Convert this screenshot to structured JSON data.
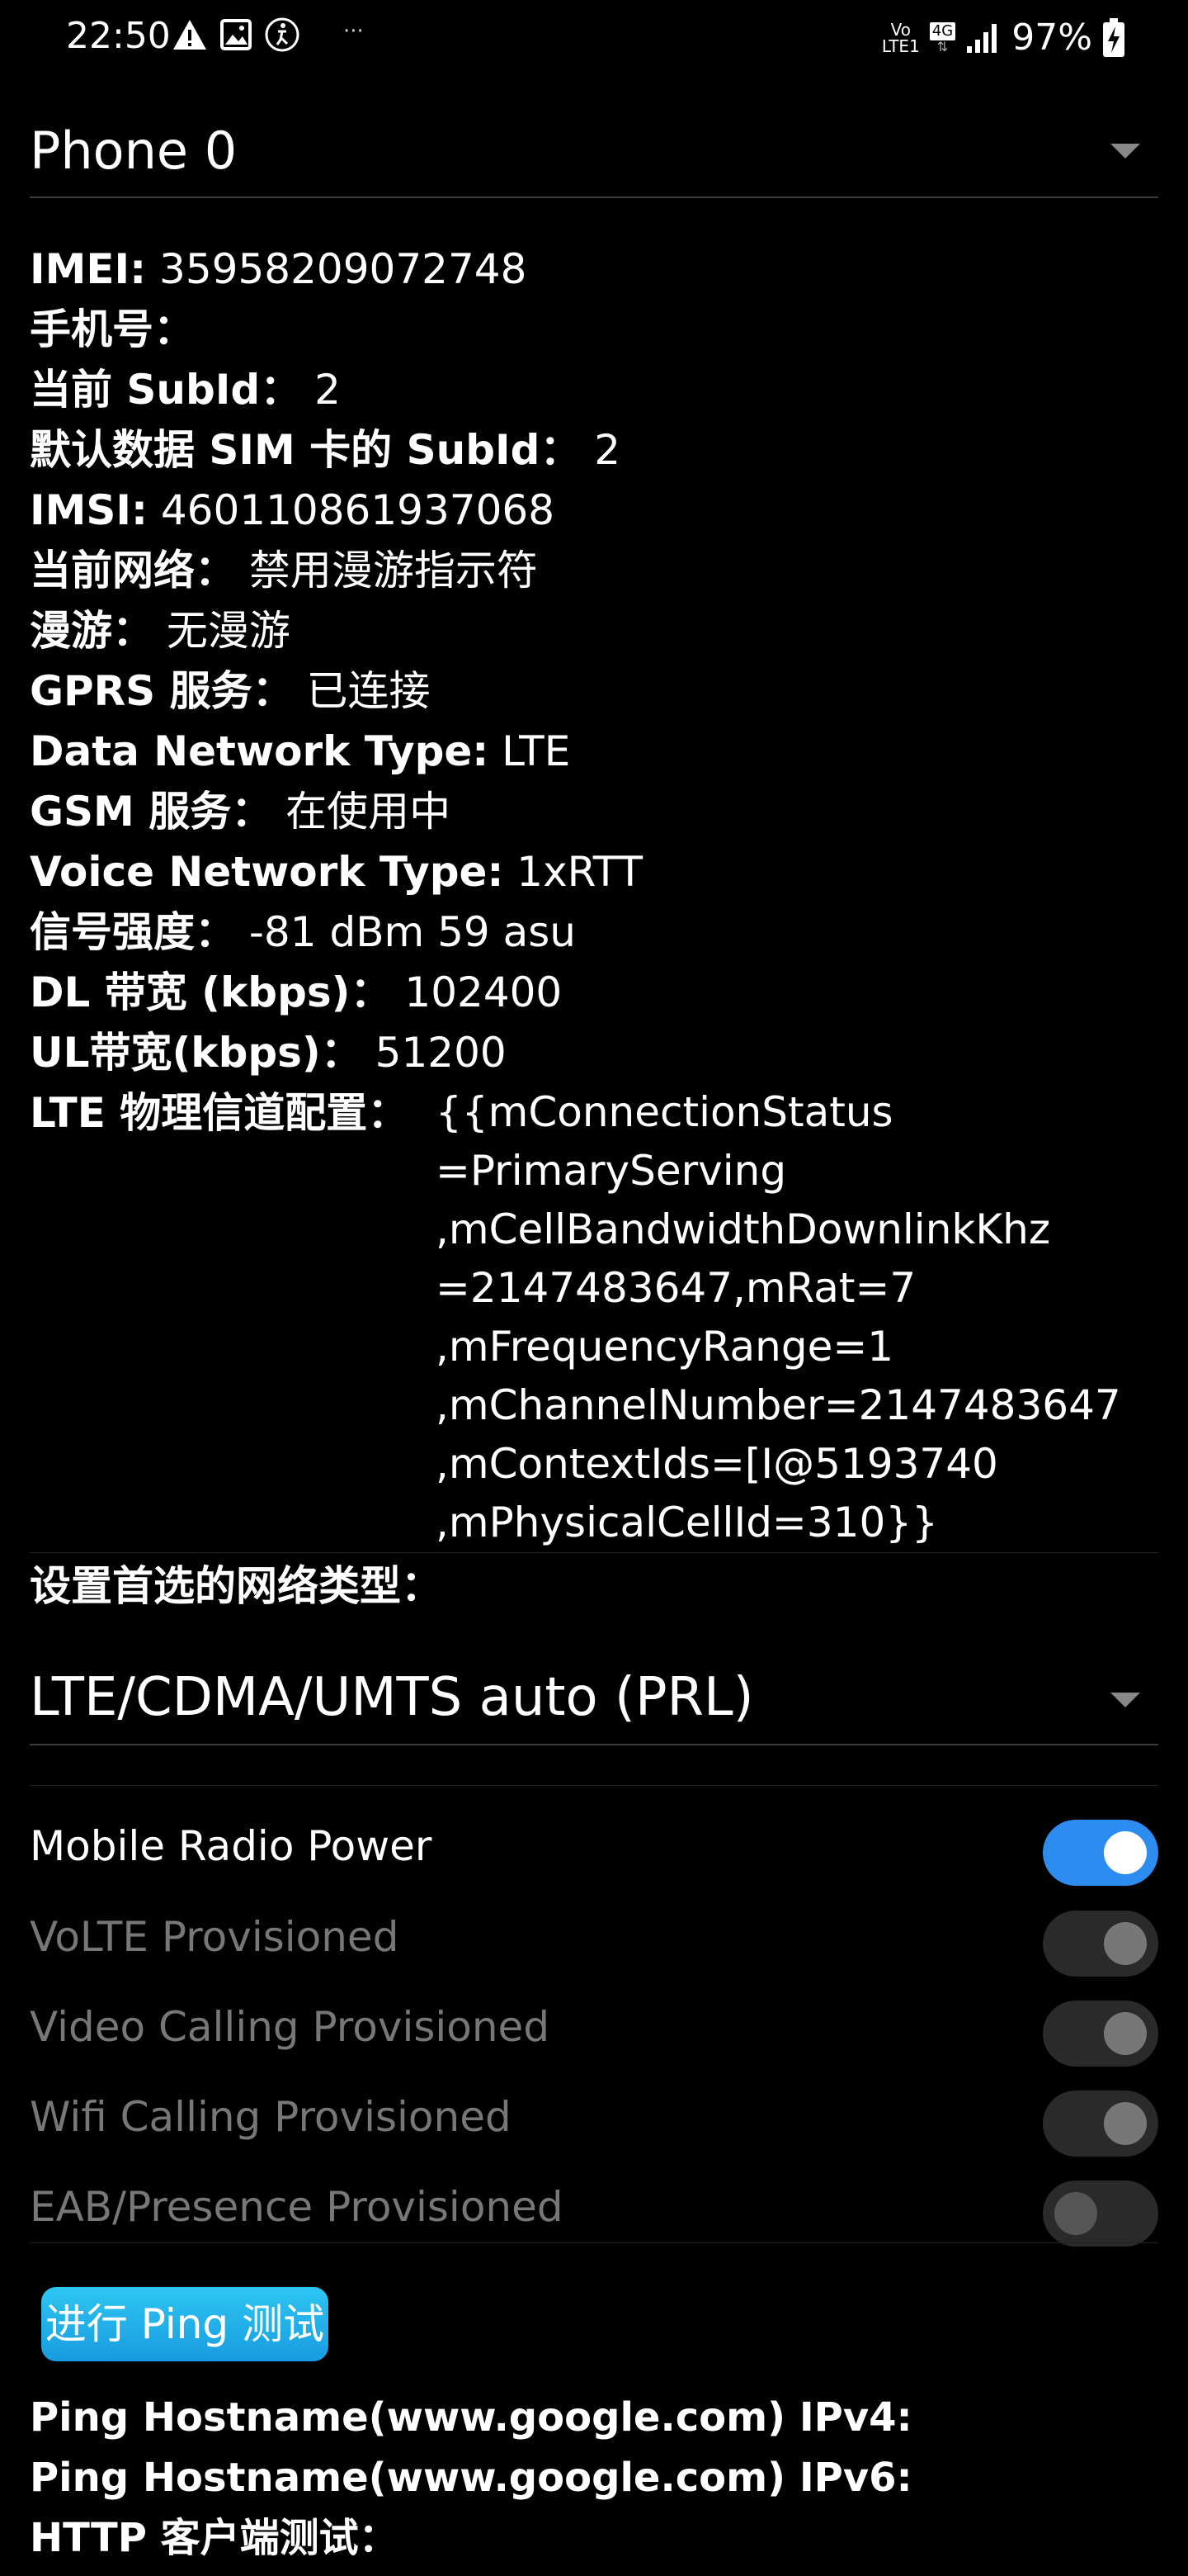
{
  "status_bar": {
    "time": "22:50",
    "left_icons": [
      "warning-icon",
      "image-icon",
      "accessibility-icon"
    ],
    "more": "···",
    "volte": "Vo\nLTE1",
    "network": "4G",
    "battery": "97%"
  },
  "phone_select": {
    "selected": "Phone 0"
  },
  "info_rows": [
    {
      "label": "IMEI:",
      "value": " 35958209072748"
    },
    {
      "label": "手机号：",
      "value": ""
    },
    {
      "label": "当前 SubId：",
      "value": " 2"
    },
    {
      "label": "默认数据 SIM 卡的 SubId：",
      "value": " 2"
    },
    {
      "label": "IMSI:",
      "value": " 460110861937068"
    },
    {
      "label": "当前网络：",
      "value": " 禁用漫游指示符"
    },
    {
      "label": "漫游：",
      "value": " 无漫游"
    },
    {
      "label": "GPRS 服务：",
      "value": " 已连接"
    },
    {
      "label": "Data Network Type:",
      "value": " LTE"
    },
    {
      "label": "GSM 服务：",
      "value": " 在使用中"
    },
    {
      "label": "Voice Network Type:",
      "value": " 1xRTT"
    },
    {
      "label": "信号强度：",
      "value": " -81 dBm   59 asu"
    },
    {
      "label": "DL 带宽 (kbps)：",
      "value": " 102400"
    },
    {
      "label": "UL带宽(kbps)：",
      "value": " 51200"
    }
  ],
  "lte_config": {
    "label": "LTE 物理信道配置：",
    "lines": [
      "{{mConnectionStatus",
      "=PrimaryServing",
      ",mCellBandwidthDownlinkKhz",
      "=2147483647,mRat=7",
      ",mFrequencyRange=1",
      ",mChannelNumber=2147483647",
      ",mContextIds=[I@5193740",
      ",mPhysicalCellId=310}}"
    ]
  },
  "preferred_network": {
    "label": "设置首选的网络类型：",
    "selected": "LTE/CDMA/UMTS auto (PRL)"
  },
  "toggles": [
    {
      "label": "Mobile Radio Power",
      "state": "on"
    },
    {
      "label": "VoLTE Provisioned",
      "state": "checked-disabled"
    },
    {
      "label": "Video Calling Provisioned",
      "state": "checked-disabled"
    },
    {
      "label": "Wifi Calling Provisioned",
      "state": "checked-disabled"
    },
    {
      "label": "EAB/Presence Provisioned",
      "state": "unchecked"
    }
  ],
  "ping": {
    "button_label": "进行 Ping 测试",
    "rows": [
      "Ping Hostname(www.google.com) IPv4:",
      "Ping Hostname(www.google.com) IPv6:",
      "HTTP 客户端测试："
    ]
  }
}
